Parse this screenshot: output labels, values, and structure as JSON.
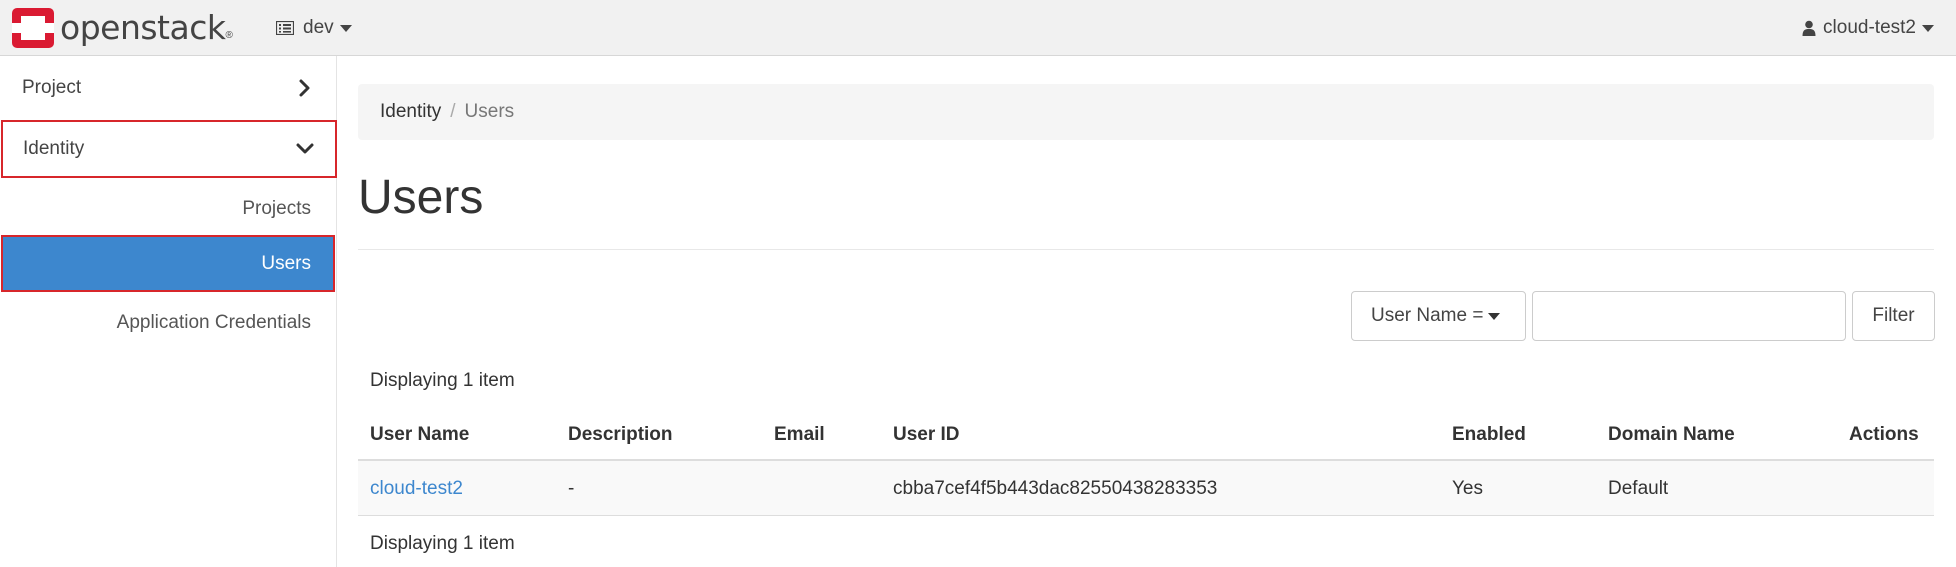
{
  "header": {
    "logo_text": "openstack",
    "project": "dev",
    "user": "cloud-test2"
  },
  "sidebar": {
    "sections": [
      {
        "label": "Project",
        "expanded": false
      },
      {
        "label": "Identity",
        "expanded": true
      }
    ],
    "identity_items": [
      {
        "label": "Projects",
        "active": false
      },
      {
        "label": "Users",
        "active": true
      },
      {
        "label": "Application Credentials",
        "active": false
      }
    ]
  },
  "breadcrumb": {
    "parent": "Identity",
    "separator": "/",
    "current": "Users"
  },
  "page": {
    "title": "Users"
  },
  "filter": {
    "field": "User Name =",
    "value": "",
    "button": "Filter"
  },
  "table": {
    "count_text": "Displaying 1 item",
    "columns": [
      "User Name",
      "Description",
      "Email",
      "User ID",
      "Enabled",
      "Domain Name",
      "Actions"
    ],
    "rows": [
      {
        "user_name": "cloud-test2",
        "description": "-",
        "email": "",
        "user_id": "cbba7cef4f5b443dac82550438283353",
        "enabled": "Yes",
        "domain_name": "Default",
        "actions": ""
      }
    ]
  },
  "colors": {
    "accent": "#3d87ce",
    "brand_red": "#da1a32",
    "highlight_border": "#d7262b"
  },
  "icons": {
    "logo": "openstack-logo-icon",
    "project": "list-icon",
    "user": "user-icon",
    "collapsed": "chevron-right-icon",
    "expanded": "chevron-down-icon"
  }
}
